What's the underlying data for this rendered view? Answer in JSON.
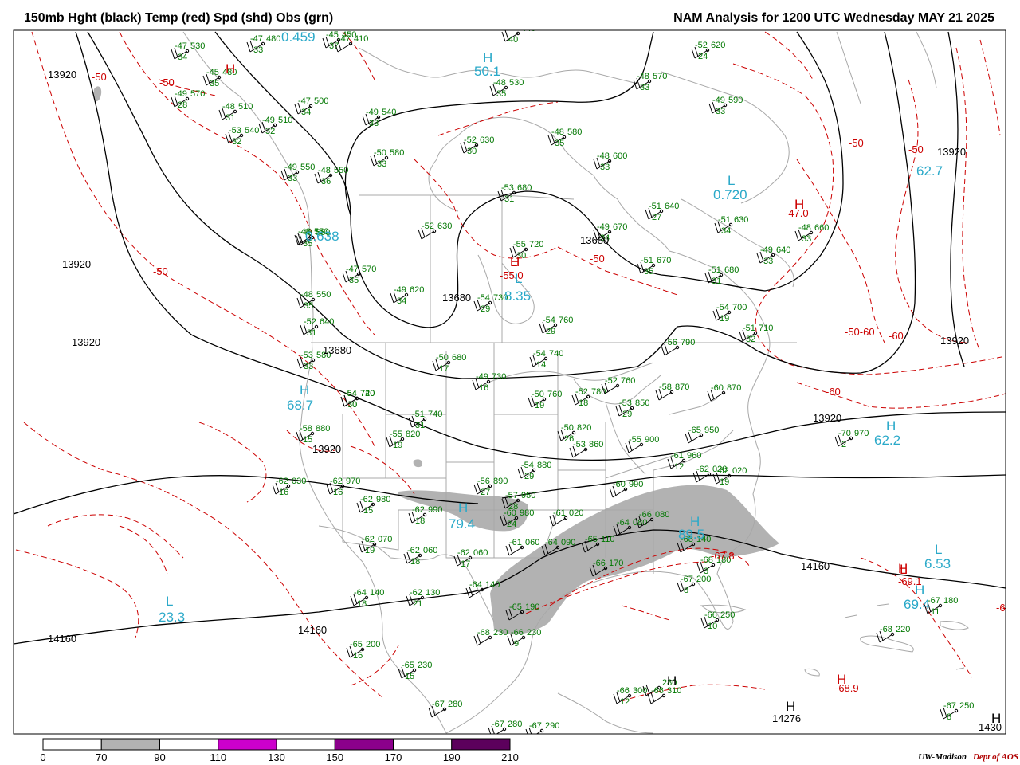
{
  "header": {
    "left_title": "150mb Hght (black) Temp (red) Spd (shd) Obs (grn)",
    "right_title": "NAM Analysis for 1200 UTC Wednesday  MAY 21 2025"
  },
  "credit": {
    "org": "UW-Madison",
    "dept": "Dept of AOS"
  },
  "colors": {
    "height": "#000000",
    "temp": "#cc0000",
    "obs": "#007700",
    "speed_label": "#2aa9c9",
    "shade": "#b2b2b2",
    "geo": "#a8a8a8"
  },
  "colorbar": {
    "labels": [
      "0",
      "70",
      "90",
      "110",
      "130",
      "150",
      "170",
      "190",
      "210"
    ],
    "fills": [
      "#ffffff",
      "#b2b2b2",
      "#ffffff",
      "#cc00cc",
      "#ffffff",
      "#8b008b",
      "#ffffff",
      "#5c005c"
    ]
  },
  "height_labels": [
    "13920",
    "13920",
    "13920",
    "13920",
    "13920",
    "13920",
    "13680",
    "13680",
    "13680",
    "13920",
    "14160",
    "14160",
    "14160",
    "14276",
    "1430"
  ],
  "temp_labels": [
    "-50",
    "-50",
    "-50",
    "-50",
    "-50",
    "-50",
    "-60",
    "-60",
    "-60",
    "-50-60",
    "-47.0",
    "-55.0",
    "-69.1",
    "-67.8",
    "-68.9",
    "-6"
  ],
  "centers": [
    {
      "kind": "H",
      "cls": "temp"
    },
    {
      "kind": "H",
      "cls": "temp"
    },
    {
      "kind": "H",
      "cls": "temp"
    },
    {
      "kind": "H",
      "cls": "temp"
    },
    {
      "kind": "H",
      "cls": "temp"
    },
    {
      "kind": "L",
      "cls": "temp"
    },
    {
      "kind": "L",
      "cls": "temp"
    },
    {
      "kind": "H",
      "cls": "height"
    },
    {
      "kind": "H",
      "cls": "height"
    },
    {
      "kind": "H",
      "cls": "height"
    },
    {
      "kind": "H",
      "cls": "speed"
    },
    {
      "kind": "H",
      "cls": "speed"
    },
    {
      "kind": "H",
      "cls": "speed"
    },
    {
      "kind": "H",
      "cls": "speed"
    },
    {
      "kind": "H",
      "cls": "speed"
    },
    {
      "kind": "H",
      "cls": "speed"
    },
    {
      "kind": "L",
      "cls": "speed"
    },
    {
      "kind": "L",
      "cls": "speed"
    },
    {
      "kind": "L",
      "cls": "speed"
    },
    {
      "kind": "L",
      "cls": "speed"
    }
  ],
  "speed_values": [
    "0.459",
    "50.1",
    "0.720",
    "62.7",
    "0.638",
    "8.35",
    "68.7",
    "62.2",
    "79.4",
    "89.5",
    "6.53",
    "69.4",
    "23.3"
  ],
  "stations": [
    {
      "t": "-47",
      "h": "530",
      "s": "34"
    },
    {
      "t": "-47",
      "h": "480",
      "s": "33"
    },
    {
      "t": "-45",
      "h": "450",
      "s": "37"
    },
    {
      "t": "-47",
      "h": "410",
      "s": ""
    },
    {
      "t": "",
      "h": "440",
      "s": "40"
    },
    {
      "t": "-45",
      "h": "480",
      "s": "35"
    },
    {
      "t": "-49",
      "h": "570",
      "s": "28"
    },
    {
      "t": "-48",
      "h": "510",
      "s": "31"
    },
    {
      "t": "-49",
      "h": "510",
      "s": "32"
    },
    {
      "t": "-53",
      "h": "540",
      "s": "32"
    },
    {
      "t": "-47",
      "h": "500",
      "s": "34"
    },
    {
      "t": "-49",
      "h": "540",
      "s": "33"
    },
    {
      "t": "-48",
      "h": "530",
      "s": "35"
    },
    {
      "t": "-52",
      "h": "620",
      "s": "24"
    },
    {
      "t": "-48",
      "h": "570",
      "s": "33"
    },
    {
      "t": "-49",
      "h": "590",
      "s": "33"
    },
    {
      "t": "-52",
      "h": "630",
      "s": "30"
    },
    {
      "t": "-48",
      "h": "580",
      "s": "35"
    },
    {
      "t": "-50",
      "h": "580",
      "s": "33"
    },
    {
      "t": "-49",
      "h": "550",
      "s": "33"
    },
    {
      "t": "-48",
      "h": "550",
      "s": "36"
    },
    {
      "t": "-48",
      "h": "600",
      "s": "33"
    },
    {
      "t": "-53",
      "h": "680",
      "s": "31"
    },
    {
      "t": "-51",
      "h": "640",
      "s": "27"
    },
    {
      "t": "-51",
      "h": "630",
      "s": "34"
    },
    {
      "t": "-48",
      "h": "660",
      "s": "33"
    },
    {
      "t": "-48",
      "h": "580",
      "s": "35"
    },
    {
      "t": "-52",
      "h": "630",
      "s": ""
    },
    {
      "t": "-49",
      "h": "670",
      "s": "34"
    },
    {
      "t": "-55",
      "h": "720",
      "s": "30"
    },
    {
      "t": "-48",
      "h": "550",
      "s": "35"
    },
    {
      "t": "-49",
      "h": "640",
      "s": "33"
    },
    {
      "t": "-51",
      "h": "670",
      "s": "35"
    },
    {
      "t": "-51",
      "h": "680",
      "s": "31"
    },
    {
      "t": "-47",
      "h": "570",
      "s": "35"
    },
    {
      "t": "-49",
      "h": "620",
      "s": "34"
    },
    {
      "t": "-54",
      "h": "730",
      "s": "29"
    },
    {
      "t": "-53",
      "h": "580",
      "s": "33"
    },
    {
      "t": "-54",
      "h": "760",
      "s": "29"
    },
    {
      "t": "-54",
      "h": "700",
      "s": "19"
    },
    {
      "t": "-51",
      "h": "710",
      "s": "32"
    },
    {
      "t": "-52",
      "h": "640",
      "s": "31"
    },
    {
      "t": "-56",
      "h": "790",
      "s": ""
    },
    {
      "t": "-54",
      "h": "740",
      "s": "14"
    },
    {
      "t": "-54",
      "h": "720",
      "s": "30"
    },
    {
      "t": "-50",
      "h": "680",
      "s": "17"
    },
    {
      "t": "-49",
      "h": "730",
      "s": "16"
    },
    {
      "t": "-52",
      "h": "780",
      "s": "18"
    },
    {
      "t": "-52",
      "h": "760",
      "s": ""
    },
    {
      "t": "-58",
      "h": "870",
      "s": ""
    },
    {
      "t": "-60",
      "h": "870",
      "s": ""
    },
    {
      "t": "-54",
      "h": "740",
      "s": "30"
    },
    {
      "t": "-51",
      "h": "740",
      "s": "31"
    },
    {
      "t": "-50",
      "h": "760",
      "s": "19"
    },
    {
      "t": "-53",
      "h": "850",
      "s": "29"
    },
    {
      "t": "-58",
      "h": "880",
      "s": "15"
    },
    {
      "t": "-55",
      "h": "820",
      "s": "19"
    },
    {
      "t": "-65",
      "h": "950",
      "s": ""
    },
    {
      "t": "-70",
      "h": "970",
      "s": "2"
    },
    {
      "t": "-50",
      "h": "820",
      "s": "26"
    },
    {
      "t": "-53",
      "h": "860",
      "s": ""
    },
    {
      "t": "-55",
      "h": "900",
      "s": ""
    },
    {
      "t": "-54",
      "h": "880",
      "s": "29"
    },
    {
      "t": "-61",
      "h": "960",
      "s": "12"
    },
    {
      "t": "-60",
      "h": "990",
      "s": ""
    },
    {
      "t": "-62",
      "h": "030",
      "s": "16"
    },
    {
      "t": "-62",
      "h": "970",
      "s": "16"
    },
    {
      "t": "-62",
      "h": "980",
      "s": "15"
    },
    {
      "t": "-56",
      "h": "890",
      "s": "27"
    },
    {
      "t": "-57",
      "h": "950",
      "s": "28"
    },
    {
      "t": "-62",
      "h": "990",
      "s": "18"
    },
    {
      "t": "-60",
      "h": "980",
      "s": "24"
    },
    {
      "t": "-61",
      "h": "020",
      "s": ""
    },
    {
      "t": "-64",
      "h": "080",
      "s": ""
    },
    {
      "t": "-66",
      "h": "080",
      "s": ""
    },
    {
      "t": "-62",
      "h": "020",
      "s": ""
    },
    {
      "t": "-62",
      "h": "070",
      "s": "19"
    },
    {
      "t": "-62",
      "h": "060",
      "s": "18"
    },
    {
      "t": "-62",
      "h": "060",
      "s": "17"
    },
    {
      "t": "-61",
      "h": "060",
      "s": ""
    },
    {
      "t": "-64",
      "h": "090",
      "s": ""
    },
    {
      "t": "-65",
      "h": "110",
      "s": ""
    },
    {
      "t": "-68",
      "h": "140",
      "s": ""
    },
    {
      "t": "-66",
      "h": "170",
      "s": ""
    },
    {
      "t": "-68",
      "h": "180",
      "s": "3"
    },
    {
      "t": "-67",
      "h": "200",
      "s": "8"
    },
    {
      "t": "-64",
      "h": "140",
      "s": "18"
    },
    {
      "t": "-62",
      "h": "130",
      "s": "21"
    },
    {
      "t": "-64",
      "h": "140",
      "s": ""
    },
    {
      "t": "-65",
      "h": "190",
      "s": ""
    },
    {
      "t": "-66",
      "h": "250",
      "s": "10"
    },
    {
      "t": "-68",
      "h": "220",
      "s": ""
    },
    {
      "t": "-67",
      "h": "180",
      "s": "11"
    },
    {
      "t": "-65",
      "h": "200",
      "s": "16"
    },
    {
      "t": "-65",
      "h": "230",
      "s": "15"
    },
    {
      "t": "-68",
      "h": "230",
      "s": ""
    },
    {
      "t": "-66",
      "h": "230",
      "s": "9"
    },
    {
      "t": "-67",
      "h": "280",
      "s": ""
    },
    {
      "t": "-67",
      "h": "280",
      "s": ""
    },
    {
      "t": "-67",
      "h": "290",
      "s": ""
    },
    {
      "t": "-66",
      "h": "300",
      "s": "12"
    },
    {
      "t": "",
      "h": "280",
      "s": ""
    },
    {
      "t": "-66",
      "h": "310",
      "s": ""
    },
    {
      "t": "-67",
      "h": "250",
      "s": "8"
    },
    {
      "t": "-48",
      "h": "550",
      "s": ""
    },
    {
      "t": "-62",
      "h": "020",
      "s": "19"
    }
  ]
}
